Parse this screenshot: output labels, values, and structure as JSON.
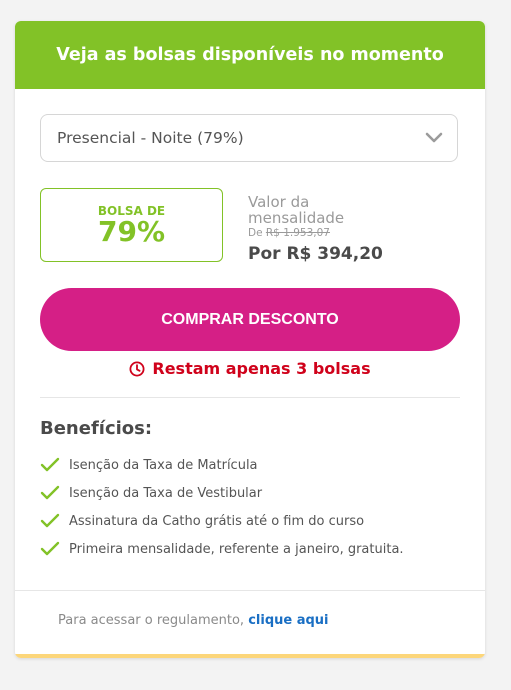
{
  "header": {
    "title": "Veja as bolsas disponíveis no momento"
  },
  "select": {
    "value": "Presencial - Noite (79%)",
    "icon": "chevron-down-icon"
  },
  "bolsa": {
    "label": "BOLSA DE",
    "percent": "79%"
  },
  "valor": {
    "title": "Valor da mensalidade",
    "de_label": "De",
    "old_price": "R$ 1.953,07",
    "new_price": "Por R$ 394,20"
  },
  "buy_button": {
    "label": "COMPRAR DESCONTO"
  },
  "remaining": {
    "text": "Restam apenas 3 bolsas",
    "icon": "clock-icon"
  },
  "benefits": {
    "title": "Benefícios:",
    "items": [
      "Isenção da Taxa de Matrícula",
      "Isenção da Taxa de Vestibular",
      "Assinatura da Catho grátis até o fim do curso",
      "Primeira mensalidade, referente a janeiro, gratuita."
    ]
  },
  "footer": {
    "text": "Para acessar o regulamento,",
    "link": "clique aqui"
  },
  "colors": {
    "header_green": "#82c227",
    "button_pink": "#d51f86",
    "alert_red": "#d0021b",
    "link_blue": "#1a6fc4",
    "bottom_bar": "#fcd67a"
  }
}
